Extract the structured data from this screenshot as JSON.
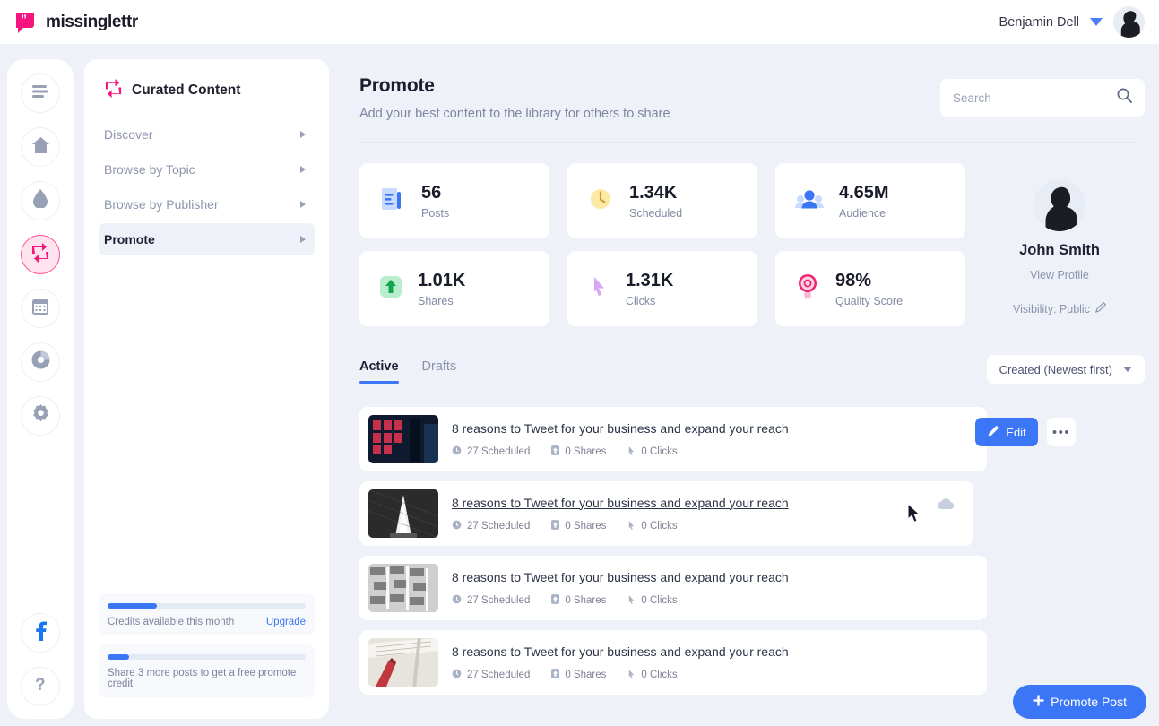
{
  "topbar": {
    "brand_name": "missinglettr",
    "brand_logo_icon": "speech-bubble-quote-icon",
    "user_name": "Benjamin Dell",
    "caret_icon": "chevron-down-icon",
    "avatar_icon": "user-avatar"
  },
  "rail": {
    "items": [
      {
        "icon": "menu-hamburger-icon",
        "name": "menu",
        "active": false
      },
      {
        "icon": "home-icon",
        "name": "home",
        "active": false
      },
      {
        "icon": "drop-icon",
        "name": "drip-campaigns",
        "active": false
      },
      {
        "icon": "curate-repost-icon",
        "name": "curated-content",
        "active": true
      },
      {
        "icon": "calendar-icon",
        "name": "calendar",
        "active": false
      },
      {
        "icon": "pie-chart-icon",
        "name": "analytics",
        "active": false
      },
      {
        "icon": "gear-icon",
        "name": "settings",
        "active": false
      }
    ],
    "bottom_items": [
      {
        "icon": "facebook-icon",
        "name": "facebook"
      },
      {
        "icon": "question-mark-icon",
        "name": "help"
      }
    ]
  },
  "panel": {
    "title": "Curated Content",
    "title_icon": "curate-repost-icon",
    "nav": [
      {
        "label": "Discover",
        "selected": false
      },
      {
        "label": "Browse by Topic",
        "selected": false
      },
      {
        "label": "Browse by Publisher",
        "selected": false
      },
      {
        "label": "Promote",
        "selected": true
      }
    ],
    "credits": [
      {
        "label": "Credits available this month",
        "link": "Upgrade",
        "progress": 25
      },
      {
        "label": "Share 3 more posts to get a free promote credit",
        "link": "",
        "progress": 11
      }
    ]
  },
  "main": {
    "title": "Promote",
    "subtitle": "Add your best content to the library for others to share",
    "search": {
      "value": "",
      "placeholder": "Search",
      "icon": "search-icon"
    },
    "stats": [
      {
        "value": "56",
        "label": "Posts",
        "icon": "document-lines-icon",
        "color": "#3b76f6"
      },
      {
        "value": "1.34K",
        "label": "Scheduled",
        "icon": "clock-icon",
        "color": "#f6d552"
      },
      {
        "value": "4.65M",
        "label": "Audience",
        "icon": "people-group-icon",
        "color": "#3b76f6"
      },
      {
        "value": "1.01K",
        "label": "Shares",
        "icon": "up-arrow-icon",
        "color": "#22c06b"
      },
      {
        "value": "1.31K",
        "label": "Clicks",
        "icon": "cursor-pointer-icon",
        "color": "#c36bf0"
      },
      {
        "value": "98%",
        "label": "Quality Score",
        "icon": "award-rosette-icon",
        "color": "#f0236e"
      }
    ],
    "profile": {
      "name": "John Smith",
      "view_profile_label": "View Profile",
      "visibility_label": "Visibility: Public",
      "visibility_edit_icon": "pencil-edit-icon"
    },
    "tabs": [
      {
        "label": "Active",
        "active": true
      },
      {
        "label": "Drafts",
        "active": false
      }
    ],
    "sort": {
      "label": "Created (Newest first)",
      "icon": "chevron-down-icon"
    },
    "posts": [
      {
        "title": "8 reasons to Tweet for your business and expand your reach",
        "scheduled": "27 Scheduled",
        "shares": "0 Shares",
        "clicks": "0 Clicks",
        "thumb": "city-neon-night",
        "hovered": false
      },
      {
        "title": "8 reasons to Tweet for your business and expand your reach",
        "scheduled": "27 Scheduled",
        "shares": "0 Shares",
        "clicks": "0 Clicks",
        "thumb": "fountain-bw",
        "hovered": true
      },
      {
        "title": "8 reasons to Tweet for your business and expand your reach",
        "scheduled": "27 Scheduled",
        "shares": "0 Shares",
        "clicks": "0 Clicks",
        "thumb": "building-facade-bw",
        "hovered": false
      },
      {
        "title": "8 reasons to Tweet for your business and expand your reach",
        "scheduled": "27 Scheduled",
        "shares": "0 Shares",
        "clicks": "0 Clicks",
        "thumb": "notebook-pen",
        "hovered": false
      }
    ],
    "row_actions": {
      "edit_label": "Edit",
      "edit_icon": "pencil-edit-icon",
      "more_label": "•••",
      "cloud_icon": "cloud-icon"
    },
    "fab": {
      "label": "Promote Post",
      "plus_icon": "plus-icon"
    }
  },
  "meta_icons": {
    "scheduled": "clock-icon",
    "shares": "up-arrow-icon",
    "clicks": "cursor-pointer-icon"
  }
}
